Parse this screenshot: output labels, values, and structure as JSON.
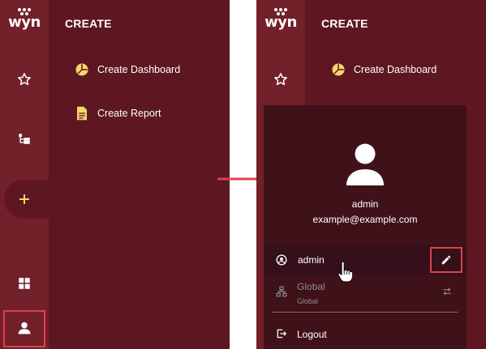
{
  "logo": {
    "text": "wyn"
  },
  "left_panel": {
    "section_title": "CREATE",
    "menu": [
      {
        "label": "Create Dashboard",
        "icon": "dashboard-pie-icon"
      },
      {
        "label": "Create Report",
        "icon": "report-document-icon"
      }
    ],
    "rail_icons": [
      "star-icon",
      "tree-icon",
      "plus-icon",
      "grid-icon",
      "user-icon"
    ]
  },
  "right_panel": {
    "section_title": "CREATE",
    "menu": [
      {
        "label": "Create Dashboard",
        "icon": "dashboard-pie-icon"
      }
    ],
    "user_popup": {
      "name": "admin",
      "email": "example@example.com",
      "rows": {
        "profile": {
          "label": "admin",
          "icon": "user-circle-icon"
        },
        "organization": {
          "label": "Global",
          "sublabel": "Global",
          "icon": "network-icon"
        },
        "logout": {
          "label": "Logout",
          "icon": "logout-icon"
        }
      }
    }
  },
  "colors": {
    "panel_bg": "#5e1720",
    "rail_bg": "#72202a",
    "popup_bg": "#3f1118",
    "accent_yellow": "#f5d76e",
    "highlight_red": "#e0404a"
  }
}
